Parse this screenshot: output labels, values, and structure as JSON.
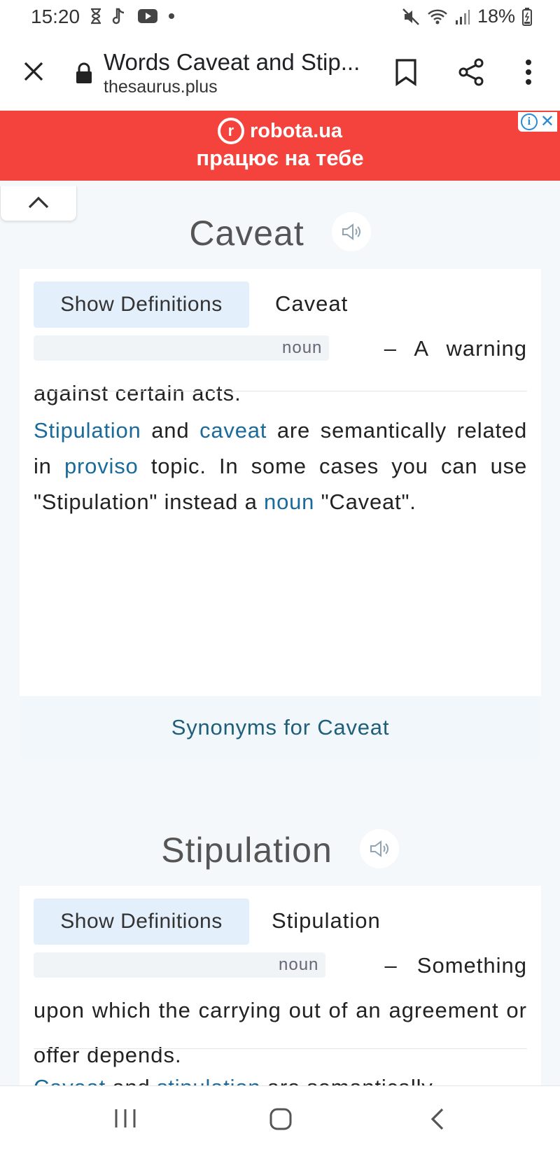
{
  "status_bar": {
    "time": "15:20",
    "battery": "18%",
    "icons_left": [
      "hourglass-icon",
      "music-note-icon",
      "youtube-icon",
      "dot-icon"
    ],
    "icons_right": [
      "mute-icon",
      "wifi-icon",
      "signal-icon",
      "battery-icon"
    ]
  },
  "browser": {
    "page_title": "Words Caveat and Stip...",
    "url": "thesaurus.plus"
  },
  "ad": {
    "brand": "robota.ua",
    "tagline": "працює на тебе",
    "background_color": "#f4433c"
  },
  "sections": [
    {
      "word": "Caveat",
      "show_definitions_label": "Show Definitions",
      "def_word": "Caveat",
      "part_of_speech": "noun",
      "definition": "A warning against certain acts.",
      "related_parts": [
        {
          "text": "Stipulation",
          "link": true
        },
        {
          "text": " and ",
          "link": false
        },
        {
          "text": "caveat",
          "link": true
        },
        {
          "text": " are semantically related in ",
          "link": false
        },
        {
          "text": "proviso",
          "link": true
        },
        {
          "text": " topic. In some cases you can use \"Stipulation\" instead a ",
          "link": false
        },
        {
          "text": "noun",
          "link": true
        },
        {
          "text": " \"Caveat\".",
          "link": false
        }
      ],
      "synonyms_label": "Synonyms for Caveat"
    },
    {
      "word": "Stipulation",
      "show_definitions_label": "Show Definitions",
      "def_word": "Stipulation",
      "part_of_speech": "noun",
      "definition": "Something upon which the carrying out of an agreement or offer depends.",
      "related_parts": [
        {
          "text": "Caveat",
          "link": true
        },
        {
          "text": " and ",
          "link": false
        },
        {
          "text": "stipulation",
          "link": true
        },
        {
          "text": " are semantically",
          "link": false
        }
      ]
    }
  ],
  "nav": {
    "buttons": [
      "recent-apps",
      "home",
      "back"
    ]
  },
  "colors": {
    "link": "#1a6a9a",
    "show_definitions_bg": "#e3f0fb",
    "page_bg": "#f4f8fb"
  }
}
